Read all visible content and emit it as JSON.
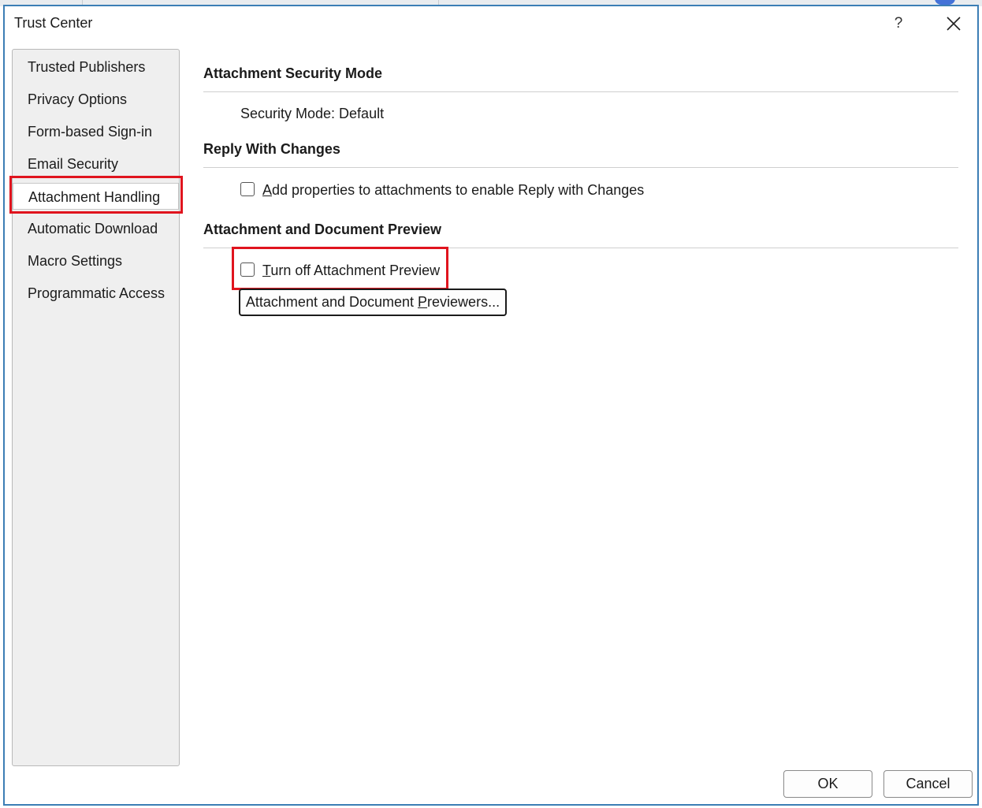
{
  "window": {
    "title": "Trust Center",
    "help_label": "?",
    "accent_color": "#3c7eb5",
    "highlight_color": "#e0141e"
  },
  "nav": {
    "items": [
      {
        "label": "Trusted Publishers",
        "selected": false
      },
      {
        "label": "Privacy Options",
        "selected": false
      },
      {
        "label": "Form-based Sign-in",
        "selected": false
      },
      {
        "label": "Email Security",
        "selected": false
      },
      {
        "label": "Attachment Handling",
        "selected": true
      },
      {
        "label": "Automatic Download",
        "selected": false
      },
      {
        "label": "Macro Settings",
        "selected": false
      },
      {
        "label": "Programmatic Access",
        "selected": false
      }
    ]
  },
  "main": {
    "security_mode": {
      "heading": "Attachment Security Mode",
      "text": "Security Mode: Default"
    },
    "reply_changes": {
      "heading": "Reply With Changes",
      "checkbox": {
        "mnemonic": "A",
        "rest": "dd properties to attachments to enable Reply with Changes",
        "checked": false
      }
    },
    "preview": {
      "heading": "Attachment and Document Preview",
      "checkbox": {
        "mnemonic": "T",
        "rest": "urn off Attachment Preview",
        "checked": false
      },
      "button": {
        "before": "Attachment and Document ",
        "mnemonic": "P",
        "after": "reviewers..."
      }
    }
  },
  "footer": {
    "ok_label": "OK",
    "cancel_label": "Cancel"
  }
}
